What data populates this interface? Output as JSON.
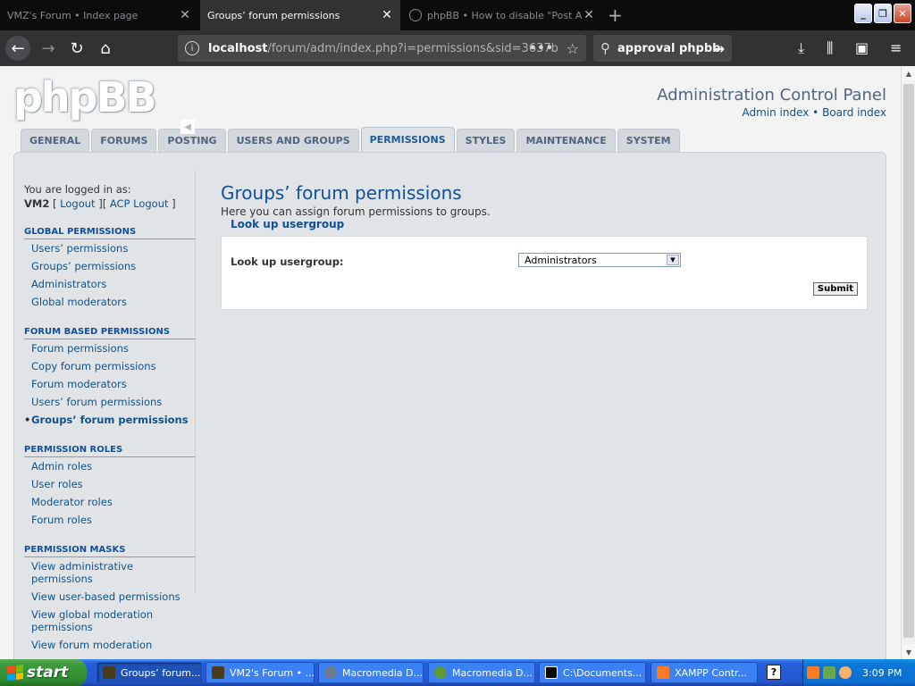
{
  "browser": {
    "tabs": [
      {
        "label": "VMZ's Forum • Index page",
        "active": false
      },
      {
        "label": "Groups’ forum permissions",
        "active": true
      },
      {
        "label": "phpBB • How to disable \"Post Ap",
        "active": false
      }
    ],
    "url_host": "localhost",
    "url_path": "/forum/adm/index.php?i=permissions&sid=3637b",
    "search_text": "approval phpbb"
  },
  "header": {
    "logo": "phpBB",
    "title": "Administration Control Panel",
    "link_admin_index": "Admin index",
    "separator": "•",
    "link_board_index": "Board index"
  },
  "main_tabs": [
    {
      "label": "GENERAL"
    },
    {
      "label": "FORUMS"
    },
    {
      "label": "POSTING"
    },
    {
      "label": "USERS AND GROUPS"
    },
    {
      "label": "PERMISSIONS",
      "active": true
    },
    {
      "label": "STYLES"
    },
    {
      "label": "MAINTENANCE"
    },
    {
      "label": "SYSTEM"
    }
  ],
  "sidebar": {
    "logged_in_as": "You are logged in as:",
    "username": "VM2",
    "logout": "Logout",
    "acp_logout": "ACP Logout",
    "sections": [
      {
        "title": "GLOBAL PERMISSIONS",
        "items": [
          "Users’ permissions",
          "Groups’ permissions",
          "Administrators",
          "Global moderators"
        ]
      },
      {
        "title": "FORUM BASED PERMISSIONS",
        "items": [
          "Forum permissions",
          "Copy forum permissions",
          "Forum moderators",
          "Users’ forum permissions",
          "Groups’ forum permissions"
        ]
      },
      {
        "title": "PERMISSION ROLES",
        "items": [
          "Admin roles",
          "User roles",
          "Moderator roles",
          "Forum roles"
        ]
      },
      {
        "title": "PERMISSION MASKS",
        "items": [
          "View administrative permissions",
          "View user-based permissions",
          "View global moderation permissions",
          "View forum moderation"
        ]
      }
    ]
  },
  "content": {
    "title": "Groups’ forum permissions",
    "description": "Here you can assign forum permissions to groups.",
    "fieldset_legend": "Look up usergroup",
    "field_label": "Look up usergroup:",
    "select_value": "Administrators",
    "submit_label": "Submit"
  },
  "taskbar": {
    "start_label": "start",
    "tasks": [
      {
        "label": "Groups’ forum...",
        "active": true
      },
      {
        "label": "VM2's Forum • ..."
      },
      {
        "label": "Macromedia D..."
      },
      {
        "label": "Macromedia D..."
      },
      {
        "label": "C:\\Documents..."
      },
      {
        "label": "XAMPP Contr..."
      }
    ],
    "clock": "3:09 PM"
  }
}
